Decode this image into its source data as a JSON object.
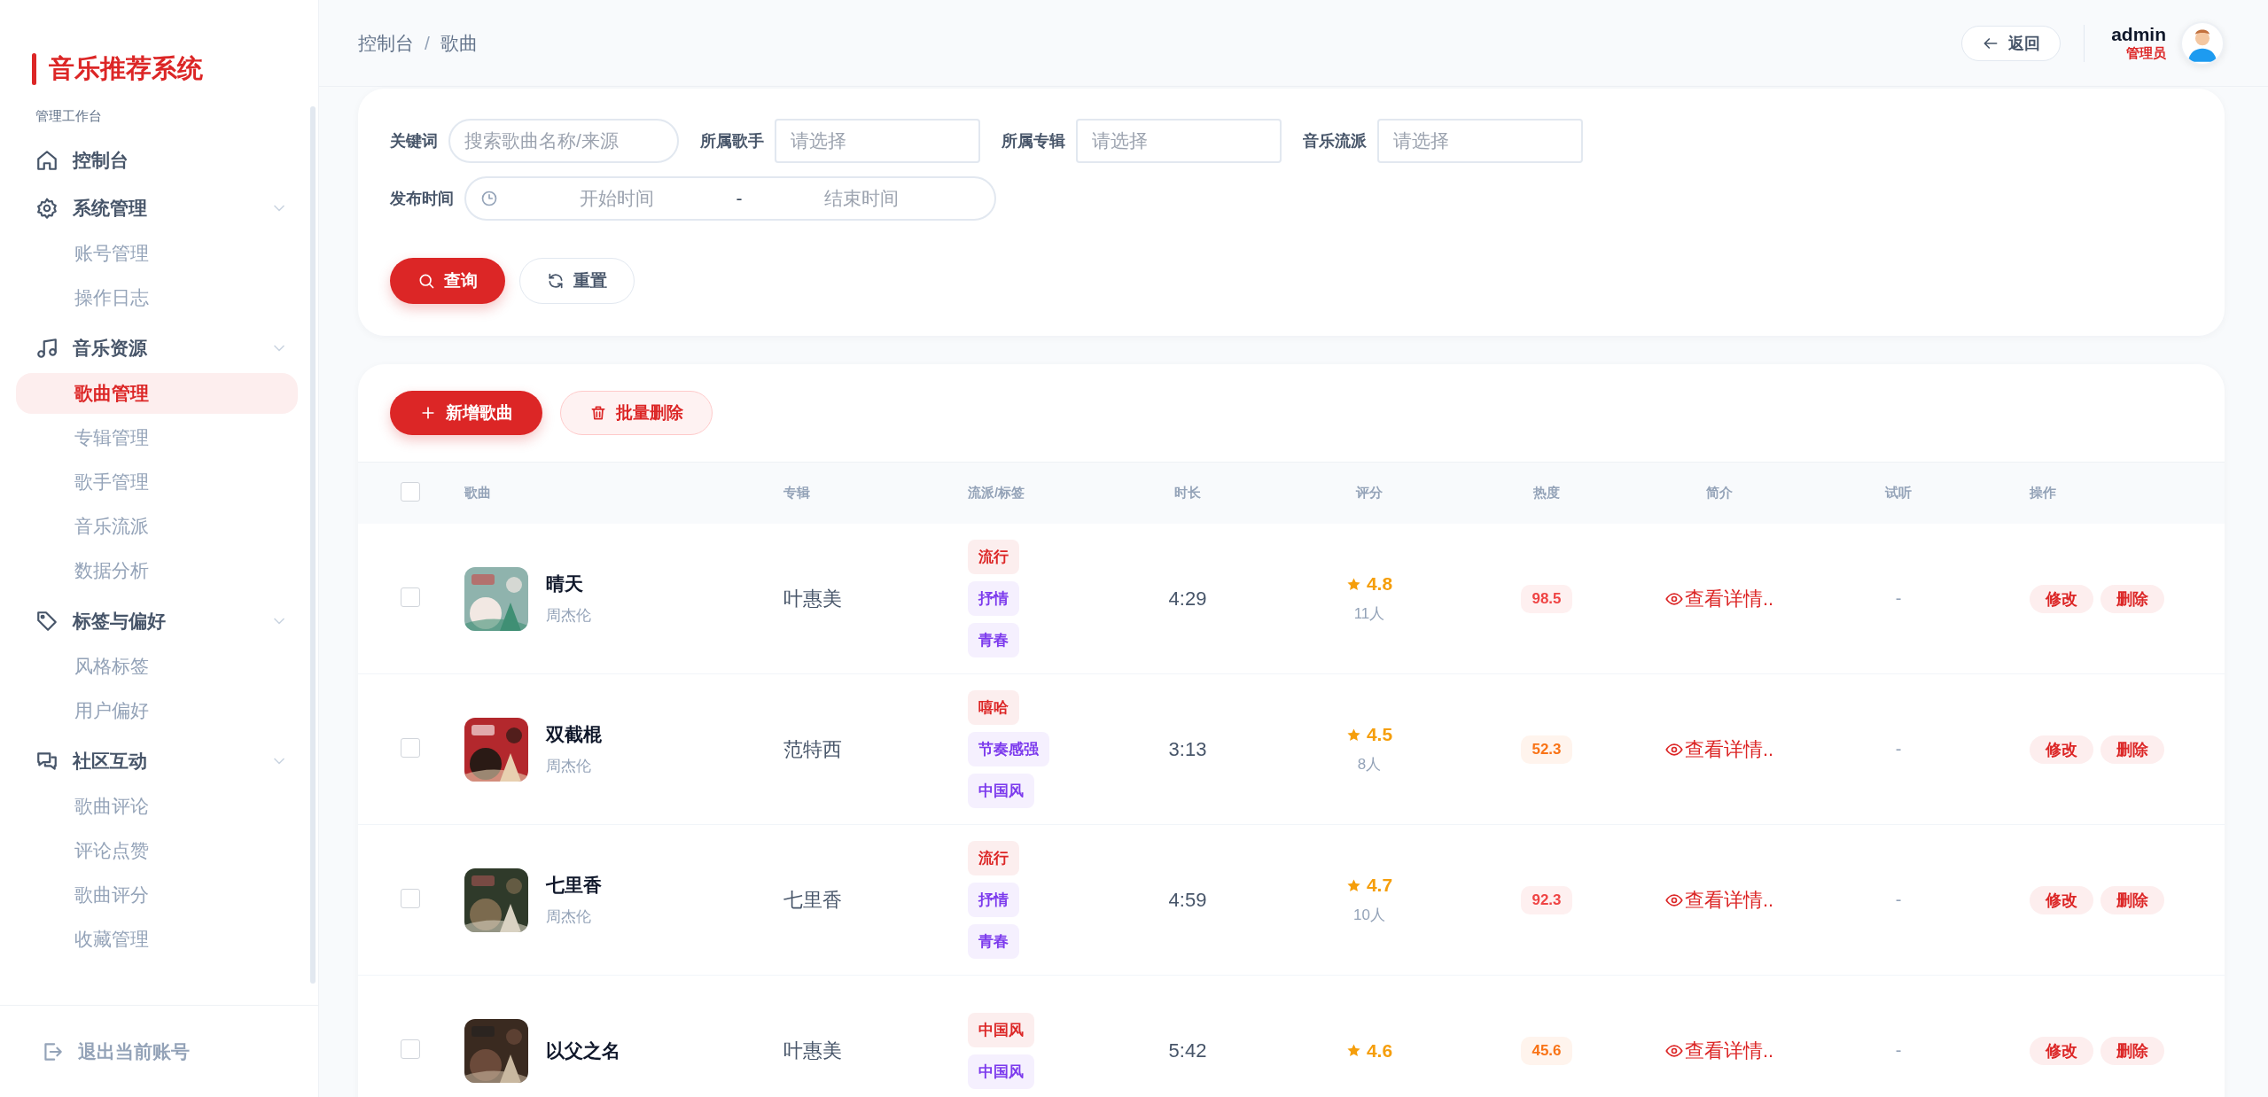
{
  "sidebar": {
    "title": "音乐推荐系统",
    "section_label": "管理工作台",
    "items": [
      {
        "kind": "link",
        "label": "控制台",
        "selected": false
      },
      {
        "kind": "group",
        "label": "系统管理",
        "expanded": true,
        "children": [
          {
            "label": "账号管理",
            "selected": false
          },
          {
            "label": "操作日志",
            "selected": false
          }
        ]
      },
      {
        "kind": "group",
        "label": "音乐资源",
        "expanded": true,
        "children": [
          {
            "label": "歌曲管理",
            "selected": true
          },
          {
            "label": "专辑管理",
            "selected": false
          },
          {
            "label": "歌手管理",
            "selected": false
          },
          {
            "label": "音乐流派",
            "selected": false
          },
          {
            "label": "数据分析",
            "selected": false
          }
        ]
      },
      {
        "kind": "group",
        "label": "标签与偏好",
        "expanded": true,
        "children": [
          {
            "label": "风格标签",
            "selected": false
          },
          {
            "label": "用户偏好",
            "selected": false
          }
        ]
      },
      {
        "kind": "group",
        "label": "社区互动",
        "expanded": true,
        "children": [
          {
            "label": "歌曲评论",
            "selected": false
          },
          {
            "label": "评论点赞",
            "selected": false
          },
          {
            "label": "歌曲评分",
            "selected": false
          },
          {
            "label": "收藏管理",
            "selected": false
          }
        ]
      }
    ],
    "logout": "退出当前账号"
  },
  "header": {
    "breadcrumb": [
      "控制台",
      "歌曲"
    ],
    "separator": "/",
    "back_button": "返回",
    "user": {
      "name": "admin",
      "role": "管理员"
    }
  },
  "filters": {
    "fields": [
      {
        "kind": "search",
        "label": "关键词",
        "placeholder": "搜索歌曲名称/来源"
      },
      {
        "kind": "select",
        "label": "所属歌手",
        "placeholder": "请选择"
      },
      {
        "kind": "select",
        "label": "所属专辑",
        "placeholder": "请选择"
      },
      {
        "kind": "select",
        "label": "音乐流派",
        "placeholder": "请选择"
      }
    ],
    "date_range": {
      "label": "发布时间",
      "start_placeholder": "开始时间",
      "separator": "-",
      "end_placeholder": "结束时间"
    },
    "search_button": "查询",
    "reset_button": "重置"
  },
  "toolbar": {
    "add_button": "新增歌曲",
    "batch_delete_button": "批量删除"
  },
  "table": {
    "select_all": false,
    "columns": [
      "歌曲",
      "专辑",
      "流派/标签",
      "时长",
      "评分",
      "热度",
      "简介",
      "试听",
      "操作"
    ],
    "rows": [
      {
        "checked": false,
        "title": "晴天",
        "artist": "周杰伦",
        "album": "叶惠美",
        "tags": [
          {
            "label": "流行",
            "color": "#dc2626"
          },
          {
            "label": "抒情",
            "color": "#7c3aed"
          },
          {
            "label": "青春",
            "color": "#7c3aed"
          }
        ],
        "duration": "4:29",
        "rating": "4.8",
        "rating_count": "11人",
        "heat": {
          "value": "98.5",
          "color": "#ef4444"
        },
        "intro": "查看详情..",
        "preview": "-",
        "actions": [
          "修改",
          "删除"
        ]
      },
      {
        "checked": false,
        "title": "双截棍",
        "artist": "周杰伦",
        "album": "范特西",
        "tags": [
          {
            "label": "嘻哈",
            "color": "#dc2626"
          },
          {
            "label": "节奏感强",
            "color": "#7c3aed"
          },
          {
            "label": "中国风",
            "color": "#7c3aed"
          }
        ],
        "duration": "3:13",
        "rating": "4.5",
        "rating_count": "8人",
        "heat": {
          "value": "52.3",
          "color": "#f97316"
        },
        "intro": "查看详情..",
        "preview": "-",
        "actions": [
          "修改",
          "删除"
        ]
      },
      {
        "checked": false,
        "title": "七里香",
        "artist": "周杰伦",
        "album": "七里香",
        "tags": [
          {
            "label": "流行",
            "color": "#dc2626"
          },
          {
            "label": "抒情",
            "color": "#7c3aed"
          },
          {
            "label": "青春",
            "color": "#7c3aed"
          }
        ],
        "duration": "4:59",
        "rating": "4.7",
        "rating_count": "10人",
        "heat": {
          "value": "92.3",
          "color": "#ef4444"
        },
        "intro": "查看详情..",
        "preview": "-",
        "actions": [
          "修改",
          "删除"
        ]
      },
      {
        "checked": false,
        "title": "以父之名",
        "album": "叶惠美",
        "tags": [
          {
            "label": "中国风",
            "color": "#dc2626"
          },
          {
            "label": "中国风",
            "color": "#7c3aed"
          }
        ],
        "duration": "5:42",
        "rating": "4.6",
        "heat": {
          "value": "45.6",
          "color": "#f97316"
        },
        "intro": "查看详情..",
        "preview": "-",
        "actions": [
          "修改",
          "删除"
        ]
      }
    ]
  }
}
